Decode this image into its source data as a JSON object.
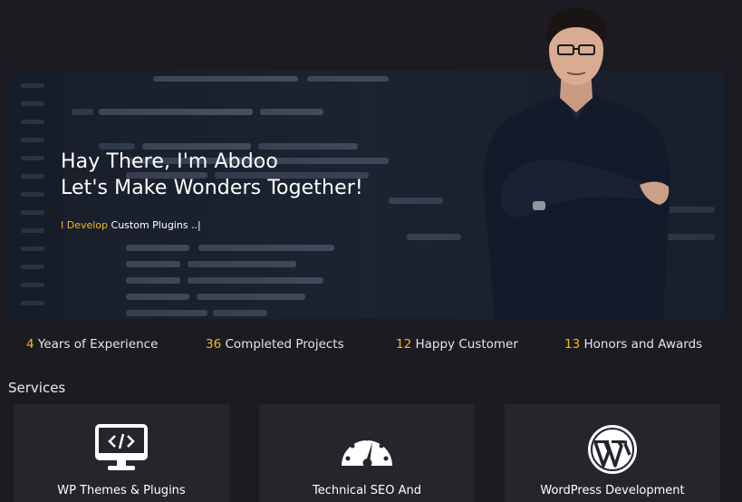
{
  "hero": {
    "greeting": "Hay There, I'm Abdoo",
    "tagline": "Let's Make Wonders Together!",
    "typing_highlight": "I Develop",
    "typing_text": " Custom Plugins ..|"
  },
  "stats": [
    {
      "value": "4",
      "label": " Years of Experience"
    },
    {
      "value": "36",
      "label": " Completed Projects"
    },
    {
      "value": "12",
      "label": " Happy Customer"
    },
    {
      "value": "13",
      "label": " Honors and Awards"
    }
  ],
  "services": {
    "title": "Services",
    "cards": [
      {
        "label": "WP Themes & Plugins",
        "icon": "monitor-code-icon"
      },
      {
        "label": "Technical SEO And",
        "icon": "speedometer-icon"
      },
      {
        "label": "WordPress Development",
        "icon": "wordpress-icon"
      }
    ]
  },
  "colors": {
    "background": "#1c1b22",
    "accent": "#f5b914",
    "card": "#26252c"
  }
}
